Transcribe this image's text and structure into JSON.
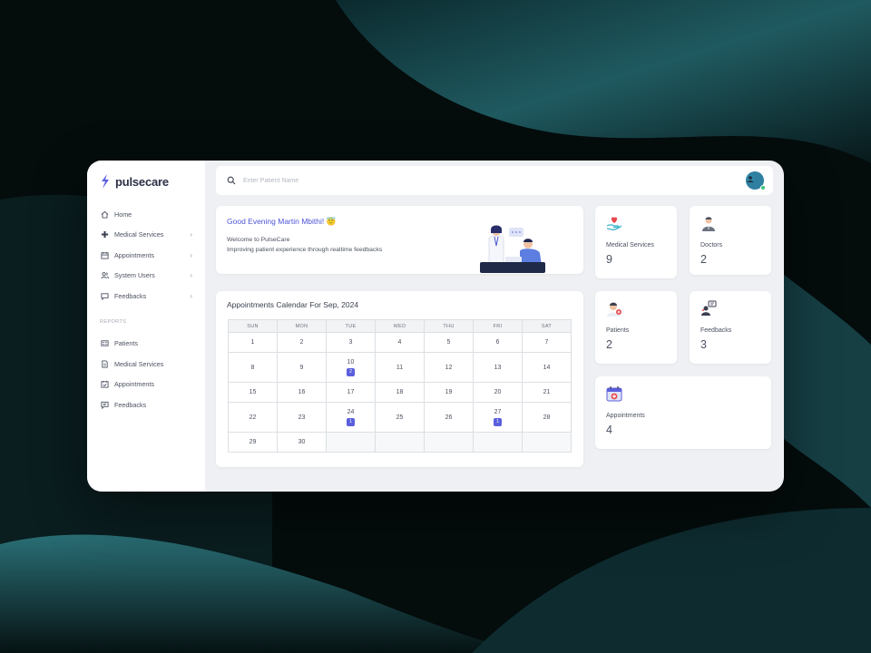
{
  "brand": {
    "name": "pulsecare",
    "accent": "#5b5fdd"
  },
  "sidebar": {
    "items": [
      {
        "label": "Home",
        "icon": "home-icon",
        "chevron": false
      },
      {
        "label": "Medical Services",
        "icon": "plus-icon",
        "chevron": true
      },
      {
        "label": "Appointments",
        "icon": "calendar-icon",
        "chevron": true
      },
      {
        "label": "System Users",
        "icon": "users-icon",
        "chevron": true
      },
      {
        "label": "Feedbacks",
        "icon": "chat-icon",
        "chevron": true
      }
    ],
    "reports_label": "REPORTS",
    "reports": [
      {
        "label": "Patients",
        "icon": "id-card-icon"
      },
      {
        "label": "Medical Services",
        "icon": "document-icon"
      },
      {
        "label": "Appointments",
        "icon": "calendar-check-icon"
      },
      {
        "label": "Feedbacks",
        "icon": "message-icon"
      }
    ]
  },
  "search": {
    "placeholder": "Enter Patient Name",
    "value": ""
  },
  "welcome": {
    "greeting": "Good Evening Martin Mbithi!",
    "emoji": "😇",
    "line1": "Welcome to PulseCare",
    "line2": "Improving patient experience through realtime feedbacks"
  },
  "stats": {
    "medical_services": {
      "label": "Medical Services",
      "value": "9"
    },
    "doctors": {
      "label": "Doctors",
      "value": "2"
    },
    "patients": {
      "label": "Patients",
      "value": "2"
    },
    "feedbacks": {
      "label": "Feedbacks",
      "value": "3"
    },
    "appointments": {
      "label": "Appointments",
      "value": "4"
    }
  },
  "calendar": {
    "title": "Appointments Calendar For Sep, 2024",
    "weekdays": [
      "SUN",
      "MON",
      "TUE",
      "WED",
      "THU",
      "FRI",
      "SAT"
    ],
    "weeks": [
      [
        {
          "d": "1"
        },
        {
          "d": "2"
        },
        {
          "d": "3"
        },
        {
          "d": "4"
        },
        {
          "d": "5"
        },
        {
          "d": "6"
        },
        {
          "d": "7"
        }
      ],
      [
        {
          "d": "8"
        },
        {
          "d": "9"
        },
        {
          "d": "10",
          "badge": "2"
        },
        {
          "d": "11"
        },
        {
          "d": "12"
        },
        {
          "d": "13"
        },
        {
          "d": "14"
        }
      ],
      [
        {
          "d": "15"
        },
        {
          "d": "16"
        },
        {
          "d": "17"
        },
        {
          "d": "18"
        },
        {
          "d": "19"
        },
        {
          "d": "20"
        },
        {
          "d": "21"
        }
      ],
      [
        {
          "d": "22"
        },
        {
          "d": "23"
        },
        {
          "d": "24",
          "badge": "1"
        },
        {
          "d": "25"
        },
        {
          "d": "26"
        },
        {
          "d": "27",
          "badge": "1"
        },
        {
          "d": "28"
        }
      ],
      [
        {
          "d": "29"
        },
        {
          "d": "30"
        },
        {
          "d": ""
        },
        {
          "d": ""
        },
        {
          "d": ""
        },
        {
          "d": ""
        },
        {
          "d": ""
        }
      ]
    ]
  }
}
